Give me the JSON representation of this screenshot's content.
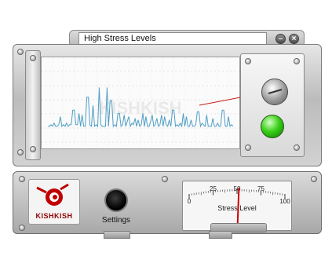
{
  "window": {
    "title": "High Stress Levels",
    "minimize_glyph": "–",
    "close_glyph": "×"
  },
  "monitor": {
    "watermark": "KISHKISH",
    "status_led": "green"
  },
  "controls": {
    "settings_label": "Settings"
  },
  "logo": {
    "text": "KISHKISH"
  },
  "gauge": {
    "label": "Stress Level",
    "ticks": [
      "0",
      "25",
      "50",
      "75",
      "100"
    ],
    "needle_value": 52
  },
  "chart_data": {
    "type": "line",
    "title": "",
    "xlabel": "",
    "ylabel": "",
    "color": "#4f9ec6",
    "values": [
      2,
      2,
      3,
      2,
      4,
      2,
      2,
      3,
      8,
      2,
      3,
      2,
      4,
      2,
      3,
      3,
      12,
      12,
      3,
      3,
      10,
      2,
      9,
      2,
      2,
      20,
      20,
      3,
      2,
      15,
      2,
      3,
      2,
      26,
      3,
      2,
      2,
      2,
      26,
      2,
      18,
      18,
      2,
      3,
      2,
      10,
      10,
      2,
      3,
      9,
      2,
      5,
      8,
      2,
      4,
      3,
      7,
      2,
      6,
      2,
      3,
      10,
      2,
      8,
      2,
      2,
      5,
      9,
      2,
      3,
      7,
      2,
      3,
      9,
      2,
      8,
      3,
      2,
      6,
      2,
      12,
      12,
      2,
      3,
      2,
      4,
      2,
      10,
      2,
      8,
      2,
      2,
      6,
      2,
      2,
      3,
      11,
      11,
      2,
      4,
      3,
      2,
      9,
      2,
      2,
      2,
      7,
      2,
      2,
      4,
      2,
      2,
      12,
      12,
      2,
      2,
      8,
      2,
      3,
      2
    ],
    "ylim": [
      0,
      32
    ]
  }
}
